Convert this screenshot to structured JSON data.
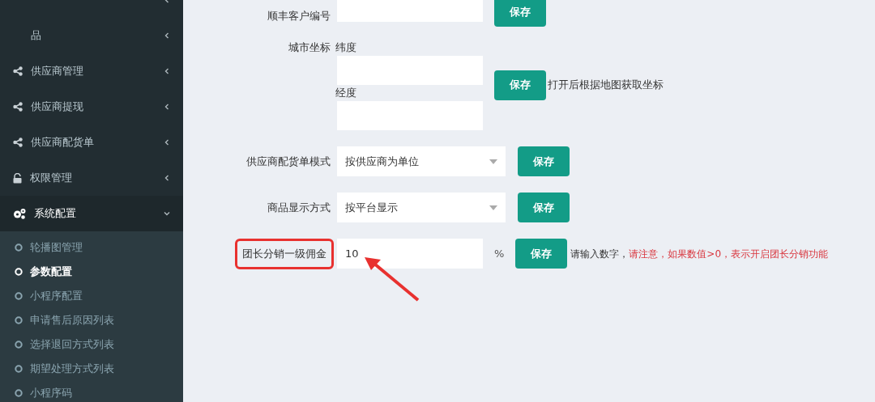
{
  "sidebar": {
    "items": [
      {
        "expanded": false
      },
      {
        "label": "品",
        "expanded": false
      },
      {
        "label": "供应商管理",
        "expanded": false
      },
      {
        "label": "供应商提现",
        "expanded": false
      },
      {
        "label": "供应商配货单",
        "expanded": false
      },
      {
        "label": "权限管理",
        "expanded": false
      },
      {
        "label": "系统配置",
        "expanded": true,
        "children": [
          {
            "label": "轮播图管理",
            "selected": false
          },
          {
            "label": "参数配置",
            "selected": true
          },
          {
            "label": "小程序配置",
            "selected": false
          },
          {
            "label": "申请售后原因列表",
            "selected": false
          },
          {
            "label": "选择退回方式列表",
            "selected": false
          },
          {
            "label": "期望处理方式列表",
            "selected": false
          },
          {
            "label": "小程序码",
            "selected": false
          }
        ]
      }
    ]
  },
  "form": {
    "rows": [
      {
        "kind": "text",
        "label": "顺丰客户编号",
        "button": "保存"
      },
      {
        "kind": "coords",
        "label": "城市坐标",
        "fields": [
          {
            "label": "纬度"
          },
          {
            "label": "经度"
          }
        ],
        "button": "保存",
        "hint": "打开后根据地图获取坐标"
      },
      {
        "kind": "select",
        "label": "供应商配货单模式",
        "value": "按供应商为单位",
        "button": "保存"
      },
      {
        "kind": "select",
        "label": "商品显示方式",
        "value": "按平台显示",
        "button": "保存"
      },
      {
        "kind": "percent",
        "label": "团长分销一级佣金",
        "highlighted": true,
        "value": "10",
        "unit": "%",
        "button": "保存",
        "hint": "请输入数字，",
        "warning": "请注意，如果数值>0，表示开启团长分销功能"
      }
    ]
  }
}
